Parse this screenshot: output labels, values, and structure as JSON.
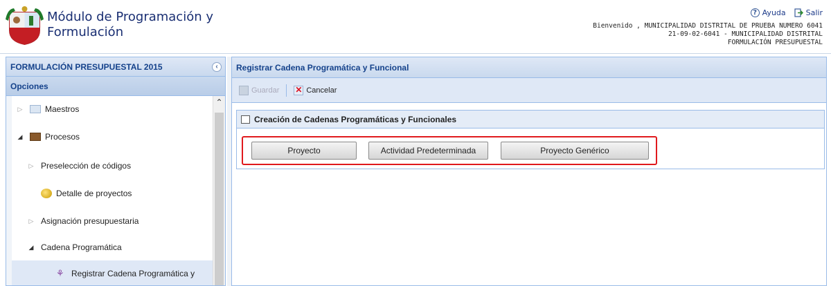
{
  "app": {
    "title": "Módulo de Programación y Formulación",
    "logo": "peru-coat-of-arms"
  },
  "top_links": {
    "help": "Ayuda",
    "exit": "Salir"
  },
  "user_info": {
    "line1": "Bienvenido , MUNICIPALIDAD DISTRITAL DE PRUEBA NUMERO 6041",
    "line2": "21-09-02-6041 - MUNICIPALIDAD DISTRITAL",
    "line3": "FORMULACIÓN PRESUPUESTAL"
  },
  "left": {
    "title": "FORMULACIÓN PRESUPUESTAL 2015",
    "options_label": "Opciones",
    "tree": [
      {
        "label": "Maestros",
        "icon": "folder-icon",
        "arrow": "▷"
      },
      {
        "label": "Procesos",
        "icon": "process-icon",
        "arrow": "◢"
      },
      {
        "label": "Preselección de códigos",
        "arrow": "▷"
      },
      {
        "label": "Detalle de proyectos",
        "icon": "detail-icon"
      },
      {
        "label": "Asignación presupuestaria",
        "arrow": "▷"
      },
      {
        "label": "Cadena Programática",
        "arrow": "◢"
      },
      {
        "label": "Registrar Cadena Programática y",
        "icon": "register-icon"
      }
    ]
  },
  "right": {
    "title": "Registrar Cadena Programática y Funcional",
    "toolbar": {
      "save": "Guardar",
      "cancel": "Cancelar"
    },
    "section_title": "Creación de Cadenas Programáticas y Funcionales",
    "buttons": {
      "proyecto": "Proyecto",
      "actividad": "Actividad Predeterminada",
      "generico": "Proyecto Genérico"
    }
  },
  "colors": {
    "panel_border": "#99bbe8",
    "header_text": "#15428b",
    "highlight": "#e0191d"
  }
}
